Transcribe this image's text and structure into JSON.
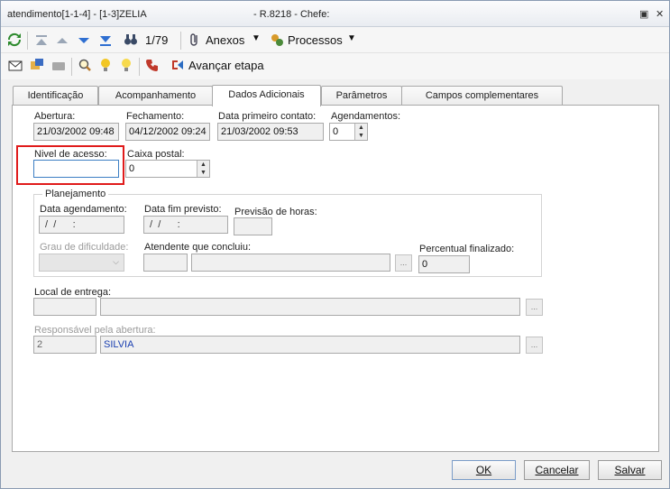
{
  "window": {
    "title": "atendimento[1-1-4] - [1-3]ZELIA",
    "title_extra": "- R.8218 - Chefe:"
  },
  "toolbar": {
    "record_position": "1/79",
    "anexos_label": "Anexos",
    "processos_label": "Processos",
    "avancar_label": "Avançar etapa"
  },
  "tabs": [
    {
      "label": "Identificação",
      "active": false
    },
    {
      "label": "Acompanhamento",
      "active": false
    },
    {
      "label": "Dados Adicionais",
      "active": true
    },
    {
      "label": "Parâmetros",
      "active": false
    },
    {
      "label": "Campos complementares",
      "active": false
    }
  ],
  "form": {
    "abertura": {
      "label": "Abertura:",
      "value": "21/03/2002 09:48"
    },
    "fechamento": {
      "label": "Fechamento:",
      "value": "04/12/2002 09:24"
    },
    "primeiro_contato": {
      "label": "Data primeiro contato:",
      "value": "21/03/2002 09:53"
    },
    "agendamentos": {
      "label": "Agendamentos:",
      "value": "0"
    },
    "nivel_acesso": {
      "label": "Nivel de acesso:",
      "value": ""
    },
    "caixa_postal": {
      "label": "Caixa postal:",
      "value": "0"
    },
    "planejamento": {
      "title": "Planejamento",
      "data_agendamento": {
        "label": "Data agendamento:",
        "value": " /  /      :"
      },
      "data_fim": {
        "label": "Data fim previsto:",
        "value": " /  /      :"
      },
      "previsao_horas": {
        "label": "Previsão de horas:",
        "value": ""
      },
      "grau_dificuldade": {
        "label": "Grau de dificuldade:"
      },
      "atendente": {
        "label": "Atendente que concluiu:",
        "code": "",
        "name": ""
      },
      "percentual": {
        "label": "Percentual finalizado:",
        "value": "0"
      }
    },
    "local_entrega": {
      "label": "Local de entrega:",
      "code": "",
      "name": ""
    },
    "responsavel": {
      "label": "Responsável pela abertura:",
      "code": "2",
      "name": "SILVIA"
    }
  },
  "buttons": {
    "ok": "OK",
    "cancelar": "Cancelar",
    "salvar": "Salvar",
    "dots": "..."
  },
  "colors": {
    "highlight": "#e01b1b",
    "focus": "#3d7fc4"
  }
}
